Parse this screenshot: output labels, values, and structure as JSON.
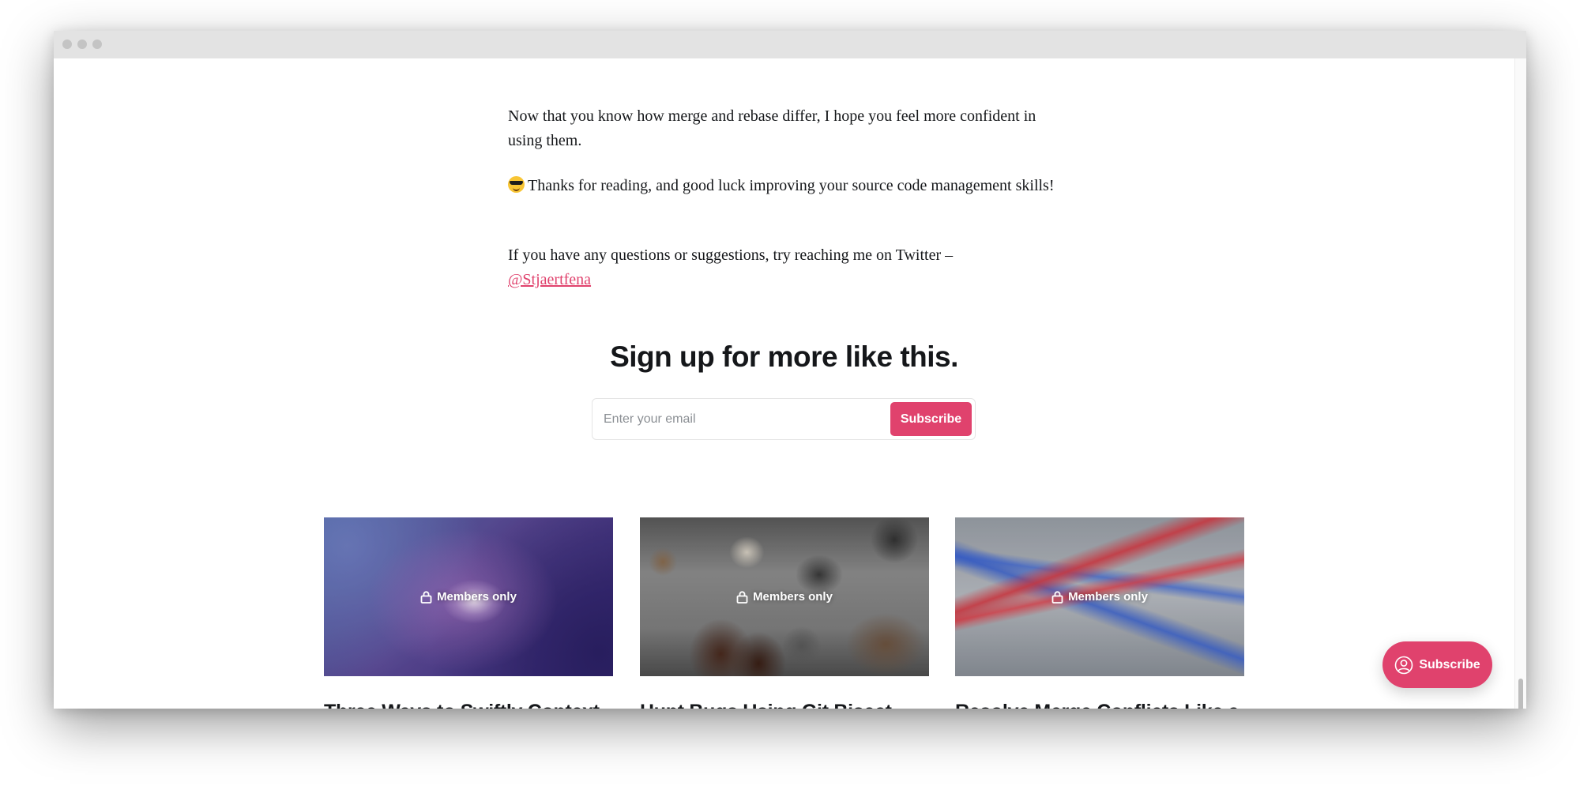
{
  "article": {
    "paragraph1": "Now that you know how merge and rebase differ, I hope you feel more confident in using them.",
    "paragraph2": "Thanks for reading, and good luck improving your source code management skills!",
    "paragraph2_icon": "sunglasses-emoji",
    "paragraph3": "If you have any questions or suggestions, try reaching me on Twitter –",
    "twitter_handle": "@Stjaertfena"
  },
  "signup": {
    "heading": "Sign up for more like this.",
    "email_placeholder": "Enter your email",
    "email_value": "",
    "button_label": "Subscribe"
  },
  "related_posts": [
    {
      "badge": "Members only",
      "title": "Three Ways to Swiftly Context Switch in Git"
    },
    {
      "badge": "Members only",
      "title": "Hunt Bugs Using Git Bisect — A Sherlock Holmes approach"
    },
    {
      "badge": "Members only",
      "title": "Resolve Merge Conflicts Like a Pro (using VSCode)"
    }
  ],
  "portal": {
    "button_label": "Subscribe",
    "icon": "user-circle-icon"
  },
  "colors": {
    "accent": "#e0426d",
    "text": "#15171a",
    "titlebar": "#e3e3e3"
  },
  "icons": {
    "lock": "lock-icon",
    "window_controls": [
      "window-dot-icon",
      "window-dot-icon",
      "window-dot-icon"
    ]
  }
}
